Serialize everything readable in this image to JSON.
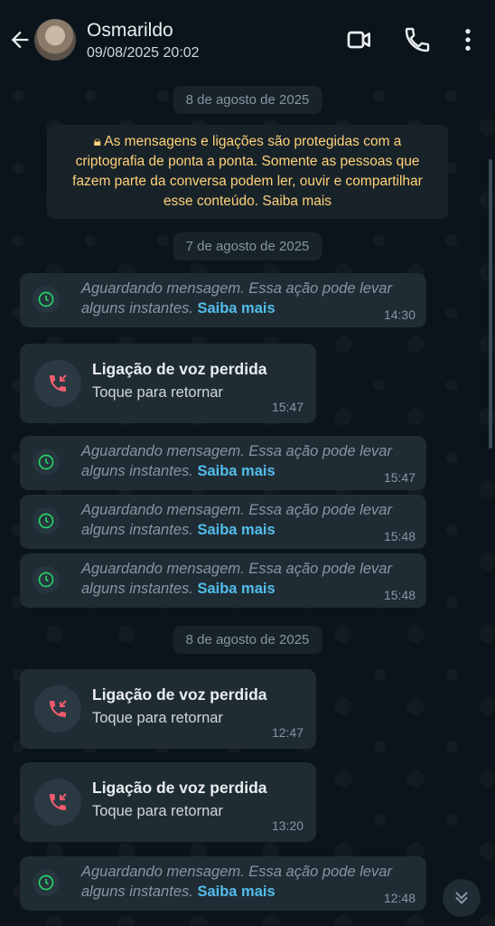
{
  "header": {
    "contact_name": "Osmarildo",
    "last_seen": "09/08/2025 20:02"
  },
  "dates": {
    "d1": "8 de agosto de 2025",
    "d2": "7 de agosto de 2025",
    "d3": "8 de agosto de 2025"
  },
  "encryption_notice": "As mensagens e ligações são protegidas com a criptografia de ponta a ponta. Somente as pessoas que fazem parte da conversa podem ler, ouvir e compartilhar esse conteúdo. Saiba mais",
  "messages": [
    {
      "type": "waiting",
      "text": "Aguardando mensagem. Essa ação pode levar alguns instantes.",
      "link": "Saiba mais",
      "time": "14:30"
    },
    {
      "type": "call",
      "title": "Ligação de voz perdida",
      "subtitle": "Toque para retornar",
      "time": "15:47"
    },
    {
      "type": "waiting",
      "text": "Aguardando mensagem. Essa ação pode levar alguns instantes.",
      "link": "Saiba mais",
      "time": "15:47"
    },
    {
      "type": "waiting",
      "text": "Aguardando mensagem. Essa ação pode levar alguns instantes.",
      "link": "Saiba mais",
      "time": "15:48"
    },
    {
      "type": "waiting",
      "text": "Aguardando mensagem. Essa ação pode levar alguns instantes.",
      "link": "Saiba mais",
      "time": "15:48"
    },
    {
      "type": "call",
      "title": "Ligação de voz perdida",
      "subtitle": "Toque para retornar",
      "time": "12:47"
    },
    {
      "type": "call",
      "title": "Ligação de voz perdida",
      "subtitle": "Toque para retornar",
      "time": "13:20"
    },
    {
      "type": "waiting",
      "text": "Aguardando mensagem. Essa ação pode levar alguns instantes.",
      "link": "Saiba mais",
      "time": "12:48"
    }
  ],
  "icons": {
    "back": "arrow-left-icon",
    "video": "video-call-icon",
    "voice": "phone-icon",
    "menu": "more-vert-icon",
    "clock": "clock-icon",
    "missed": "missed-call-icon",
    "scroll_down": "double-chevron-down-icon"
  },
  "colors": {
    "background": "#0b141a",
    "bubble": "#1f2c34",
    "link": "#53bdeb",
    "encryption_text": "#ffd279",
    "missed_call": "#f15c6d",
    "clock": "#25d366"
  }
}
